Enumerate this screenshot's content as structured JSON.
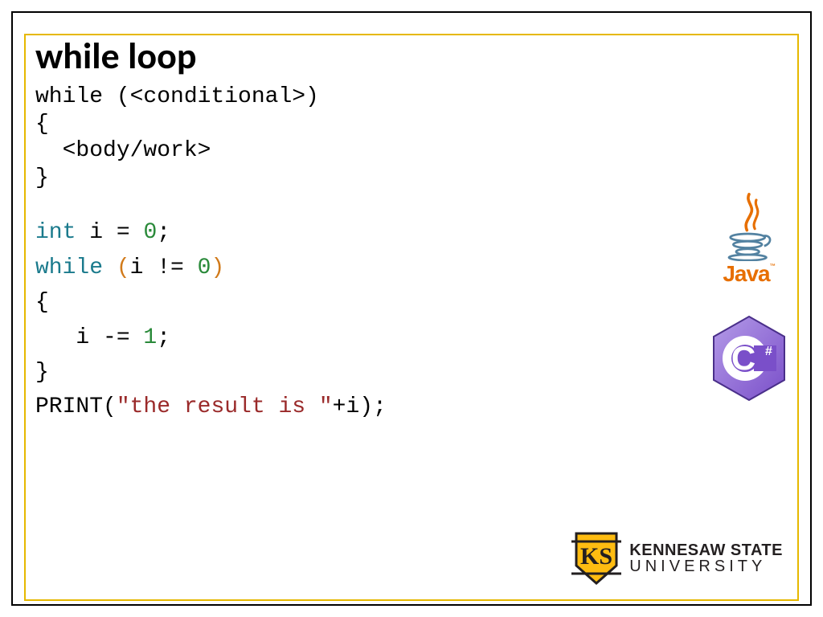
{
  "title": "while loop",
  "pseudo": {
    "l1": "while (<conditional>)",
    "l2": "{",
    "l3": "  <body/work>",
    "l4": "}"
  },
  "code": {
    "int": "int",
    "i_eq": " i = ",
    "zero1": "0",
    "semi": ";",
    "while": "while",
    "sp": " ",
    "lp": "(",
    "cond_mid": "i != ",
    "zero2": "0",
    "rp": ")",
    "open": "{",
    "body_pre": "   i -= ",
    "one": "1",
    "close": "}",
    "print_pre": "PRINT(",
    "str": "\"the result is \"",
    "print_post": "+i);"
  },
  "logos": {
    "java": "Java",
    "java_tm": "™",
    "csharp": "C#",
    "ksu_line1": "KENNESAW STATE",
    "ksu_line2": "UNIVERSITY"
  }
}
